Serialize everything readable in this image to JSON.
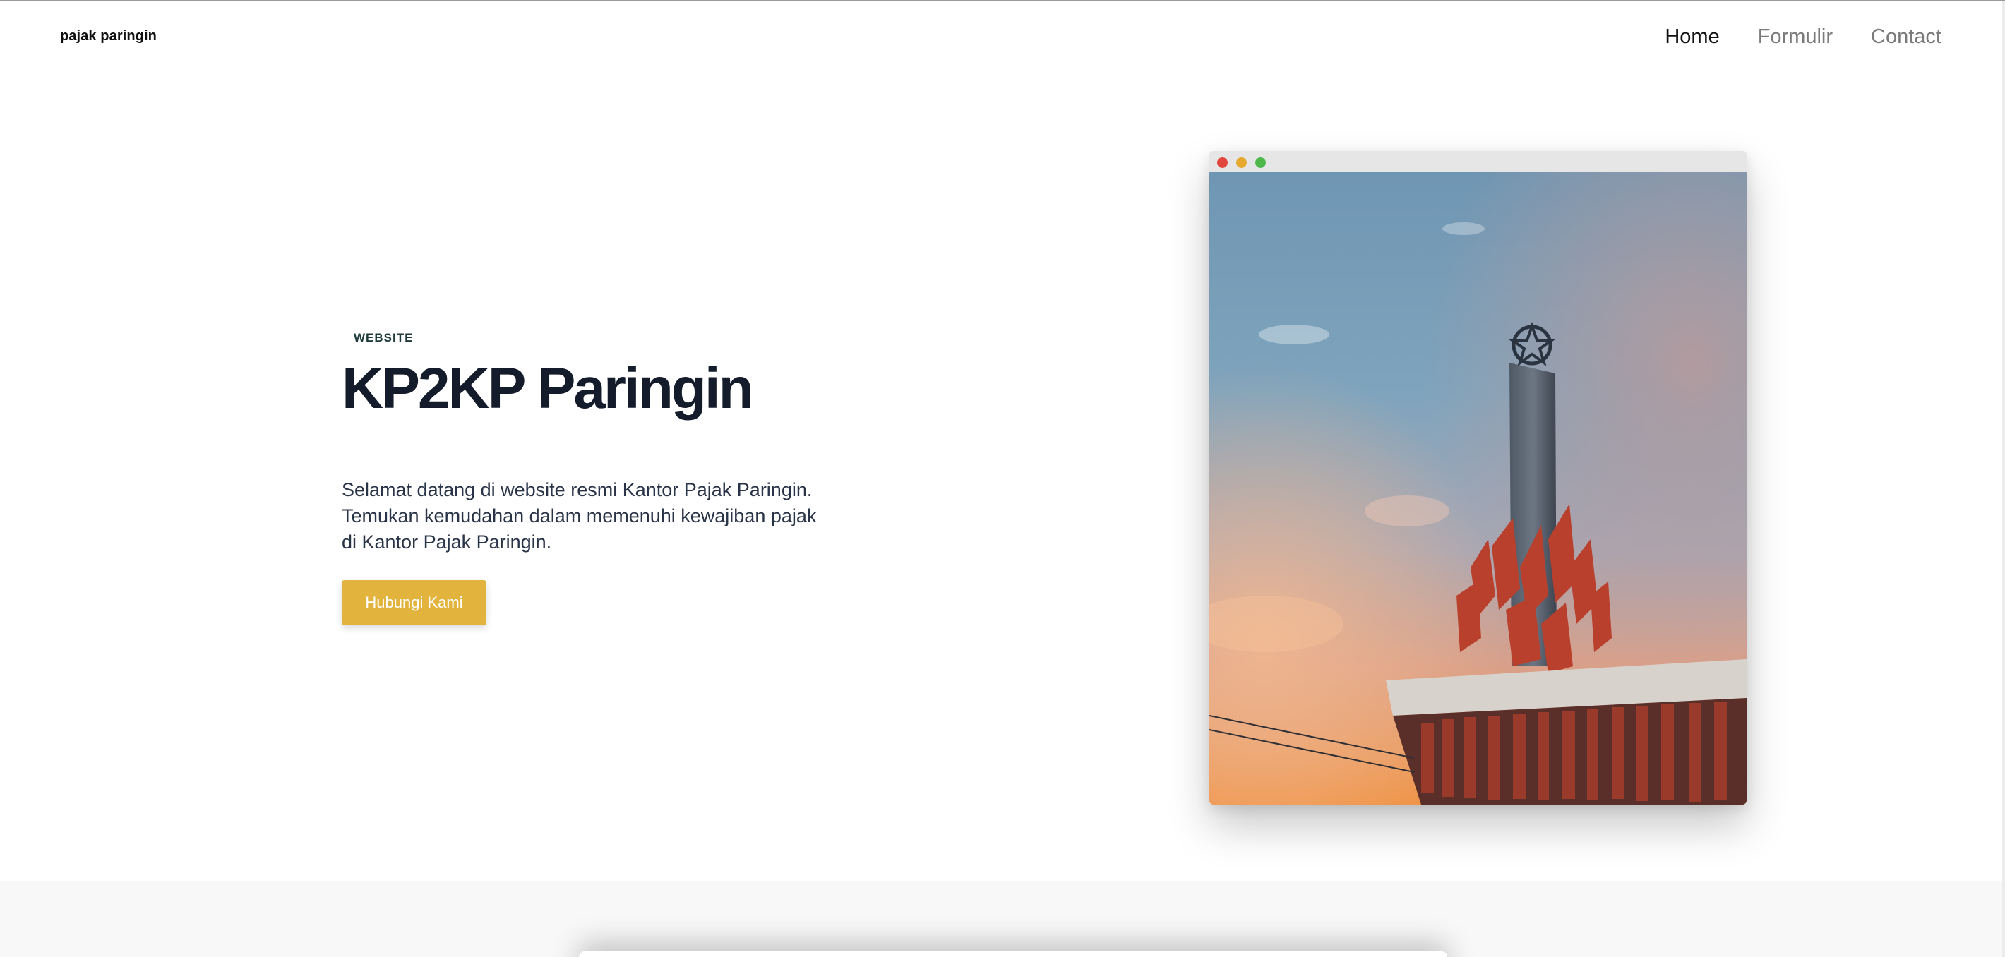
{
  "nav": {
    "brand": "pajak paringin",
    "links": [
      {
        "label": "Home",
        "active": true
      },
      {
        "label": "Formulir",
        "active": false
      },
      {
        "label": "Contact",
        "active": false
      }
    ]
  },
  "hero": {
    "eyebrow": "WEBSITE",
    "title": "KP2KP Paringin",
    "description": "Selamat datang di website resmi Kantor Pajak Paringin. Temukan kemudahan dalam memenuhi kewajiban pajak di Kantor Pajak Paringin.",
    "cta_label": "Hubungi Kami",
    "image": {
      "subject": "monument-tower-at-sunset",
      "window_dots": [
        "#e2473d",
        "#e6a92f",
        "#4fb84a"
      ]
    }
  },
  "colors": {
    "accent": "#e3b43d",
    "title": "#141b2b",
    "eyebrow": "#1d3b3a"
  }
}
